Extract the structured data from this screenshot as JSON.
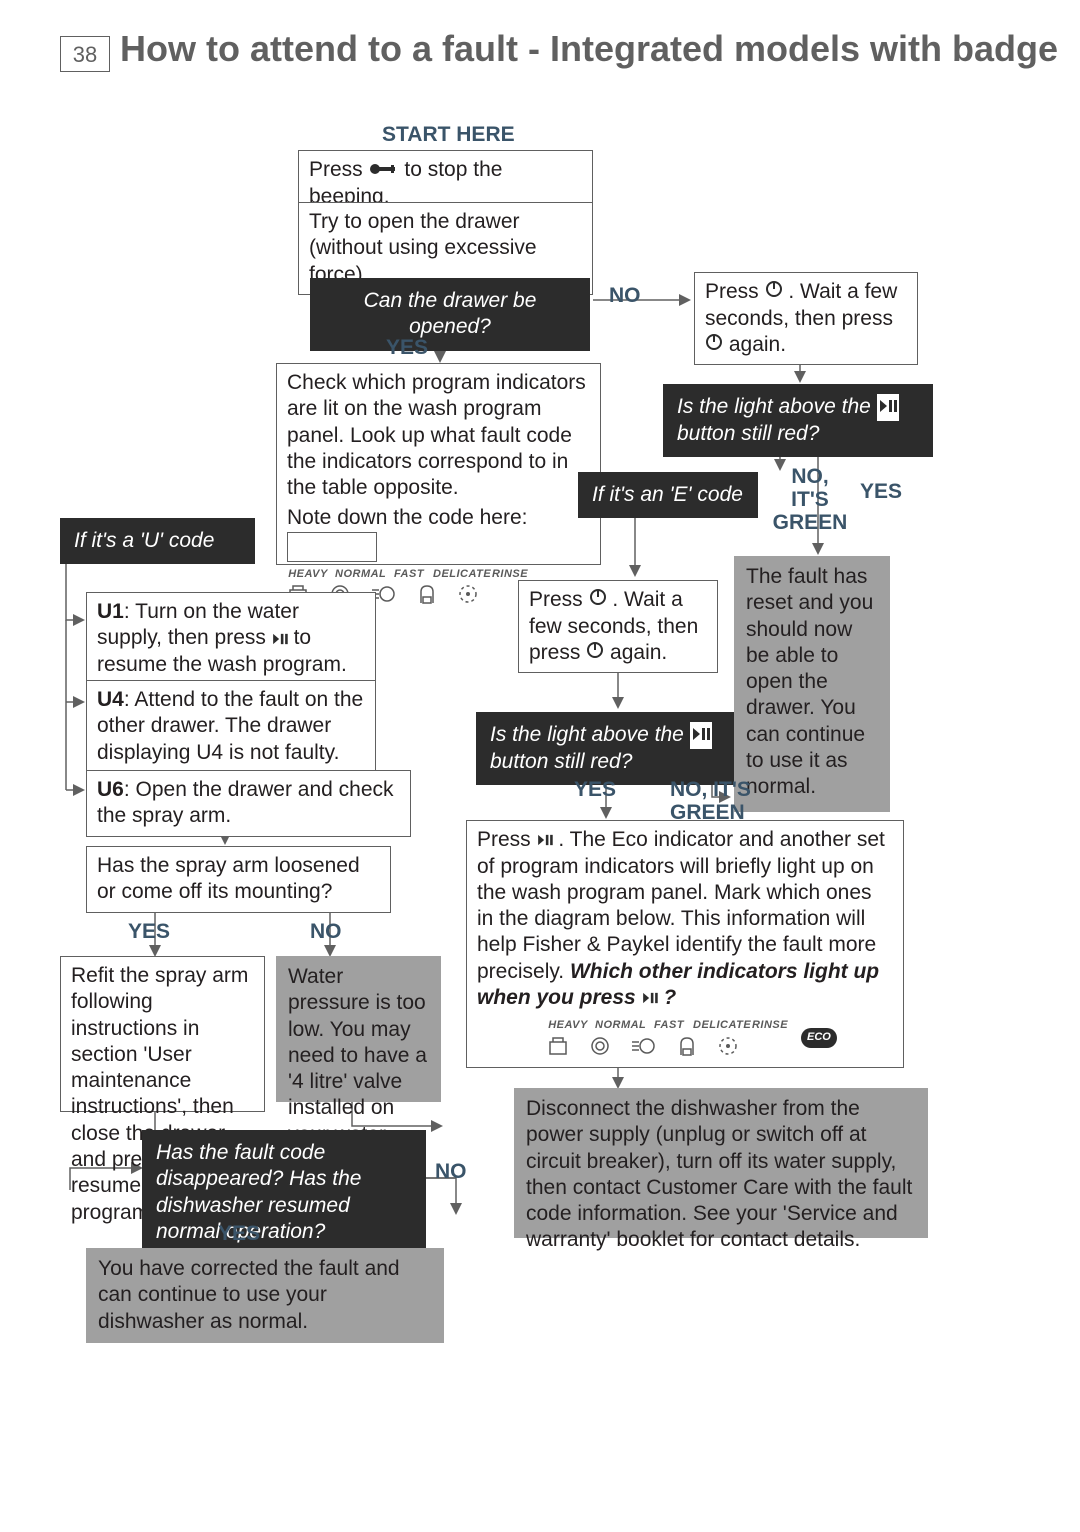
{
  "page_number": "38",
  "title": "How to attend to a fault - Integrated models with badge",
  "start_here": "START HERE",
  "step1a": "Press ",
  "step1b": " to stop the beeping.",
  "step2": "Try to open the drawer (without using excessive force).",
  "q_drawer": "Can the drawer be opened?",
  "yes": "YES",
  "no": "NO",
  "press_power1a": "Press ",
  "press_power1b": " . Wait a few seconds, then press ",
  "press_power1c": " again.",
  "q_light_red_a": "Is the light above the ",
  "q_light_red_b": " button still red?",
  "no_green": "NO, IT'S GREEN",
  "check_indicators": "Check which program indicators are lit on the wash program panel. Look up what fault code the indicators correspond to in the table opposite.",
  "note_code": "Note down the code here:",
  "if_u": "If it's a 'U' code",
  "if_e": "If it's an 'E' code",
  "u1_label": "U1",
  "u1_text": ": Turn on the water supply, then press ",
  "u1_text2": " to resume the wash program.",
  "u4_label": "U4",
  "u4_text": ": Attend to the fault on the other drawer. The drawer displaying U4 is not faulty.",
  "u6_label": "U6",
  "u6_text": ": Open the drawer and check the spray arm.",
  "fault_reset": "The fault has reset and you should now be able to open the drawer. You can continue to use it as normal.",
  "spray_q": "Has the spray arm loosened or come off its mounting?",
  "refit_a": "Refit the spray arm following instructions in section 'User maintenance instructions', then close the drawer and press ",
  "refit_b": " to resume the wash program.",
  "water_pressure": "Water pressure is too low. You may need to have a '4 litre' valve installed on your water supply.",
  "press_play_a": "Press ",
  "press_play_b": " . The Eco indicator and another set of program indicators will briefly light up on the wash program panel. Mark which ones in the diagram below. This information will help Fisher & Paykel identify the fault more precisely. ",
  "press_play_bold": "Which other indicators light up when you press ",
  "press_play_q": " ?",
  "disconnect": "Disconnect the dishwasher from the power supply (unplug or switch off at circuit breaker), turn off its water supply, then contact Customer Care with the fault code information. See your 'Service and warranty' booklet for contact details.",
  "q_disappeared": "Has the fault code disappeared? Has the dishwasher resumed normal operation?",
  "corrected": "You have corrected the fault and can continue to use your dishwasher as normal.",
  "prog_labels": [
    "HEAVY",
    "NORMAL",
    "FAST",
    "DELICATE",
    "RINSE"
  ],
  "eco_label": "ECO"
}
